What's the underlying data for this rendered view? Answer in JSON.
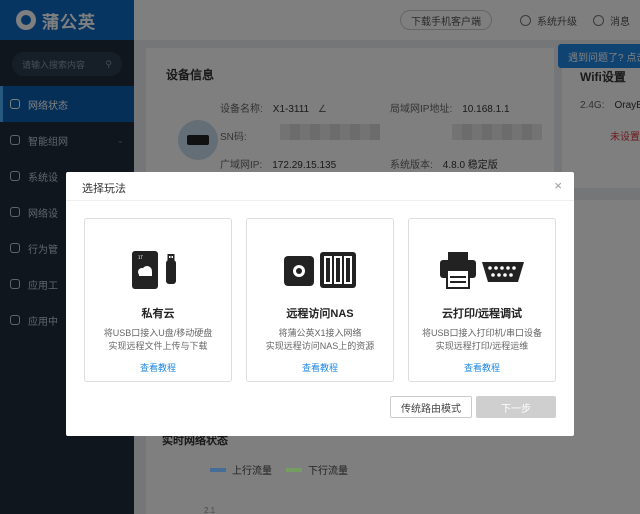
{
  "app": {
    "brand": "蒲公英"
  },
  "sidebar": {
    "search_placeholder": "请输入搜索内容",
    "items": [
      {
        "label": "网络状态"
      },
      {
        "label": "智能组网"
      },
      {
        "label": "系统设"
      },
      {
        "label": "网络设"
      },
      {
        "label": "行为管"
      },
      {
        "label": "应用工"
      },
      {
        "label": "应用中"
      }
    ]
  },
  "topbar": {
    "download_label": "下载手机客户端",
    "upgrade_label": "系统升级",
    "messages_label": "消息"
  },
  "help": {
    "label": "遇到问题了? 点击"
  },
  "device": {
    "title": "设备信息",
    "name_label": "设备名称:",
    "name_value": "X1-3111",
    "sn_label": "SN码:",
    "wan_label": "广域网IP:",
    "wan_value": "172.29.15.135",
    "lan_label": "局域网IP地址:",
    "lan_value": "10.168.1.1",
    "version_label": "系统版本:",
    "version_value": "4.8.0 稳定版"
  },
  "wifi": {
    "title": "Wifi设置",
    "band_label": "2.4G:",
    "ssid": "OrayBo",
    "status": "未设置"
  },
  "realtime": {
    "title": "实时网络状态",
    "up_label": "上行流量",
    "down_label": "下行流量",
    "up_color": "#1f5fa8",
    "down_color": "#6ab04c",
    "axis_tick": "2.1"
  },
  "modal": {
    "title": "选择玩法",
    "close": "×",
    "options": [
      {
        "name": "私有云",
        "desc1": "将USB口接入U盘/移动硬盘",
        "desc2": "实现远程文件上传与下载",
        "link": "查看教程"
      },
      {
        "name": "远程访问NAS",
        "desc1": "将蒲公英X1接入网络",
        "desc2": "实现远程访问NAS上的资源",
        "link": "查看教程"
      },
      {
        "name": "云打印/远程调试",
        "desc1": "将USB口接入打印机/串口设备",
        "desc2": "实现远程打印/远程运维",
        "link": "查看教程"
      }
    ],
    "traditional_label": "传统路由模式",
    "next_label": "下一步"
  }
}
